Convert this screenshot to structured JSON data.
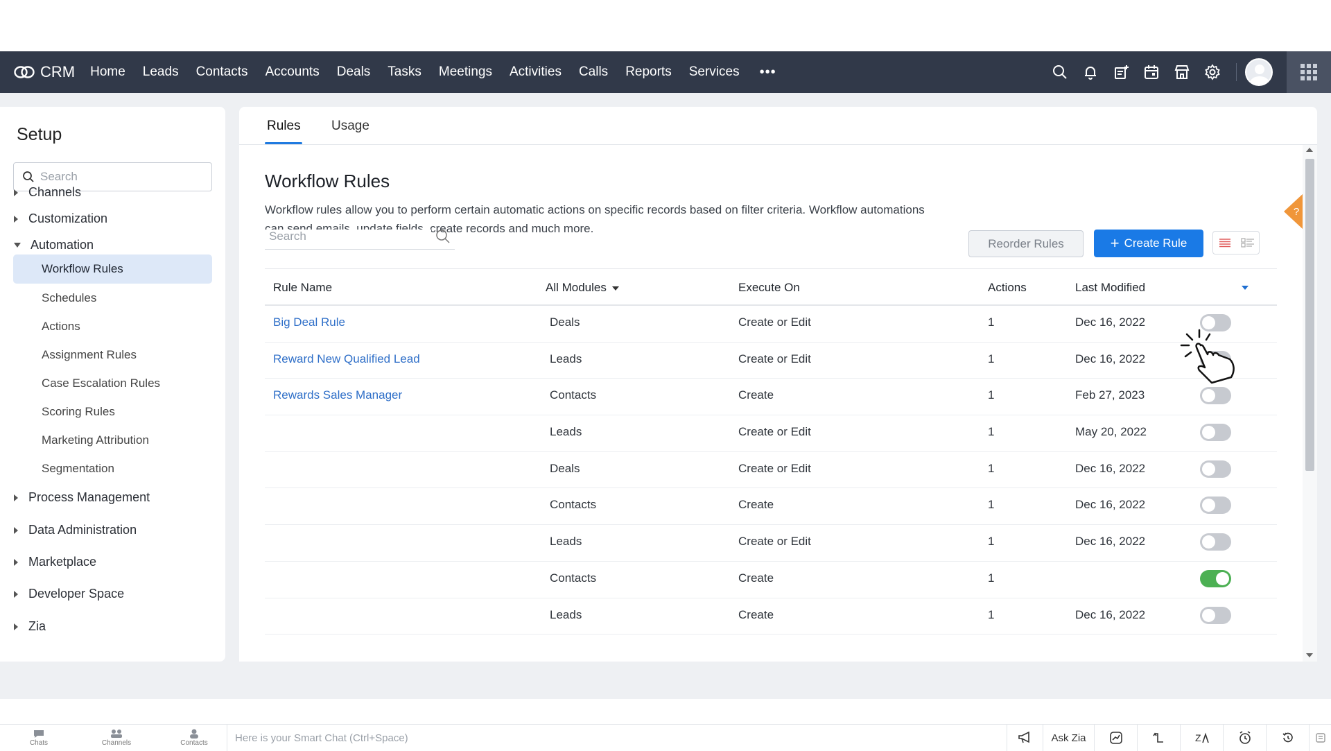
{
  "brand": {
    "name": "CRM"
  },
  "nav": {
    "items": [
      "Home",
      "Leads",
      "Contacts",
      "Accounts",
      "Deals",
      "Tasks",
      "Meetings",
      "Activities",
      "Calls",
      "Reports",
      "Services"
    ],
    "more": "•••"
  },
  "sidebar": {
    "title": "Setup",
    "search_placeholder": "Search",
    "sections": {
      "channels": "Channels",
      "customization": "Customization",
      "automation": "Automation",
      "process_management": "Process Management",
      "data_administration": "Data Administration",
      "marketplace": "Marketplace",
      "developer_space": "Developer Space",
      "zia": "Zia"
    },
    "automation_items": [
      "Workflow Rules",
      "Schedules",
      "Actions",
      "Assignment Rules",
      "Case Escalation Rules",
      "Scoring Rules",
      "Marketing Attribution",
      "Segmentation"
    ]
  },
  "tabs": {
    "rules": "Rules",
    "usage": "Usage"
  },
  "page": {
    "title": "Workflow Rules",
    "description": "Workflow rules allow you to perform certain automatic actions on specific records based on filter criteria. Workflow automations can send emails, update fields, create records and much more.",
    "search_placeholder": "Search",
    "reorder_label": "Reorder Rules",
    "create_label": "Create Rule",
    "create_plus": "+"
  },
  "table": {
    "headers": {
      "rule_name": "Rule Name",
      "modules": "All Modules",
      "execute_on": "Execute On",
      "actions": "Actions",
      "last_modified": "Last Modified"
    },
    "rows": [
      {
        "name": "Big Deal Rule",
        "module": "Deals",
        "execute_on": "Create or Edit",
        "actions": "1",
        "modified": "Dec 16, 2022",
        "active": false
      },
      {
        "name": "Reward New Qualified Lead",
        "module": "Leads",
        "execute_on": "Create or Edit",
        "actions": "1",
        "modified": "Dec 16, 2022",
        "active": false
      },
      {
        "name": "Rewards Sales Manager",
        "module": "Contacts",
        "execute_on": "Create",
        "actions": "1",
        "modified": "Feb 27, 2023",
        "active": false
      },
      {
        "name": "",
        "module": "Leads",
        "execute_on": "Create or Edit",
        "actions": "1",
        "modified": "May 20, 2022",
        "active": false
      },
      {
        "name": "",
        "module": "Deals",
        "execute_on": "Create or Edit",
        "actions": "1",
        "modified": "Dec 16, 2022",
        "active": false
      },
      {
        "name": "",
        "module": "Contacts",
        "execute_on": "Create",
        "actions": "1",
        "modified": "Dec 16, 2022",
        "active": false
      },
      {
        "name": "",
        "module": "Leads",
        "execute_on": "Create or Edit",
        "actions": "1",
        "modified": "Dec 16, 2022",
        "active": false
      },
      {
        "name": "",
        "module": "Contacts",
        "execute_on": "Create",
        "actions": "1",
        "modified": "",
        "active": true
      },
      {
        "name": "",
        "module": "Leads",
        "execute_on": "Create",
        "actions": "1",
        "modified": "Dec 16, 2022",
        "active": false
      }
    ]
  },
  "footer": {
    "tabs": [
      "Chats",
      "Channels",
      "Contacts"
    ],
    "smart_chat_placeholder": "Here is your Smart Chat (Ctrl+Space)",
    "ask_zia": "Ask Zia"
  },
  "colors": {
    "nav_bg": "#313949",
    "accent": "#1a7ae6",
    "link": "#2f6fc8",
    "toggle_on": "#4cb053",
    "help": "#f0963a"
  }
}
